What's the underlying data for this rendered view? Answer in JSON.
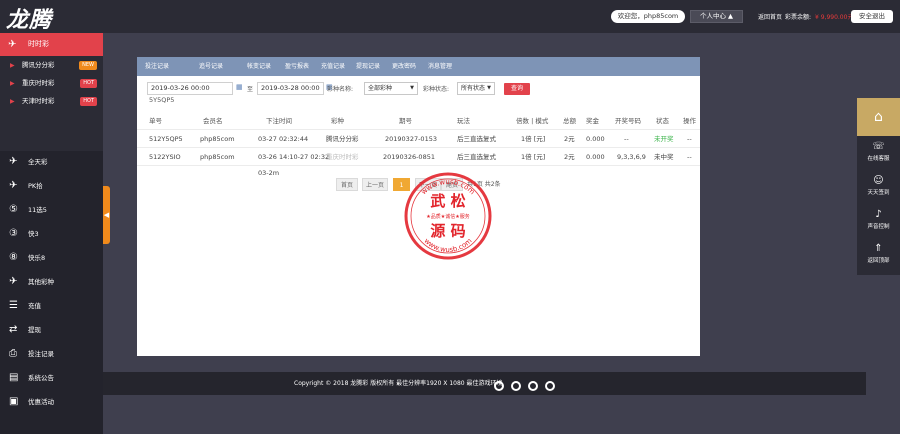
{
  "header": {
    "logo": "龙腾",
    "welcome": "欢迎您，php85com",
    "center_label": "个人中心",
    "back_home": "返回首页",
    "balance_label": "彩票余额:",
    "balance_value": "¥ 9,990.00元",
    "logout": "安全退出"
  },
  "sidebar": {
    "head": "时时彩",
    "subs": [
      {
        "label": "腾讯分分彩",
        "tag": "NEW"
      },
      {
        "label": "重庆时时彩",
        "tag": "HOT"
      },
      {
        "label": "天津时时彩",
        "tag": "HOT"
      }
    ],
    "items": [
      {
        "label": "全天彩",
        "icon": "lottery-icon",
        "glyph": "✈"
      },
      {
        "label": "PK拾",
        "icon": "racing-icon",
        "glyph": "✈"
      },
      {
        "label": "11选5",
        "icon": "eleven-five-icon",
        "glyph": "⑤"
      },
      {
        "label": "快3",
        "icon": "fast3-icon",
        "glyph": "③"
      },
      {
        "label": "快乐8",
        "icon": "happy8-icon",
        "glyph": "⑧"
      },
      {
        "label": "其他彩种",
        "icon": "other-lottery-icon",
        "glyph": "✈"
      },
      {
        "label": "充值",
        "icon": "recharge-icon",
        "glyph": "☰"
      },
      {
        "label": "提现",
        "icon": "withdraw-icon",
        "glyph": "⇄"
      },
      {
        "label": "投注记录",
        "icon": "bet-record-icon",
        "glyph": "⎙"
      },
      {
        "label": "系统公告",
        "icon": "notice-icon",
        "glyph": "▤"
      },
      {
        "label": "优惠活动",
        "icon": "promo-icon",
        "glyph": "▣"
      }
    ]
  },
  "tabs": [
    "投注记录",
    "追号记录",
    "帐变记录",
    "盈亏报表",
    "充值记录",
    "提现记录",
    "更改密码",
    "消息管理"
  ],
  "filters": {
    "start_date": "2019-03-26 00:00",
    "to_label": "至",
    "end_date": "2019-03-28 00:00",
    "lottery_label": "彩种名称:",
    "lottery_value": "全部彩种",
    "status_label": "彩种状态:",
    "status_value": "所有状态",
    "query": "查询",
    "order_fragment": "5Y5QP5"
  },
  "table": {
    "headers": [
      "单号",
      "会员名",
      "下注时间",
      "彩种",
      "期号",
      "玩法",
      "倍数 | 模式",
      "总额",
      "奖金",
      "开奖号码",
      "状态",
      "操作"
    ],
    "rows": [
      [
        "512Y5QP5",
        "php85com",
        "03-27 02:32:44",
        "腾讯分分彩",
        "20190327-0153",
        "后三直选复式",
        "1倍 [元]",
        "2元",
        "0.000",
        "--",
        "未开奖",
        "--"
      ],
      [
        "5122YSIO",
        "php85com",
        "03-26 14:10-27 02:32",
        "重庆时时彩",
        "20190326-0851",
        "后三直选复式",
        "1倍 [元]",
        "2元",
        "0.000",
        "9,3,3,6,9",
        "未中奖",
        "--"
      ]
    ],
    "extra_time": "03-2m"
  },
  "pager": {
    "first": "首页",
    "prev": "上一页",
    "current": "1",
    "next": "下一页",
    "last": "尾页",
    "total": "共1页 共2条"
  },
  "stamp": {
    "top": "www.wusb.com",
    "mid": "★品质★诚信★服务",
    "line1": "武 松",
    "line2": "源 码",
    "bottom": "www.wusb.com"
  },
  "footer": {
    "copyright": "Copyright © 2018 龙腾彩 版权所有    最佳分辨率1920 X 1080 最佳游戏环境"
  },
  "rightbar": {
    "items": [
      {
        "label": "在线客服",
        "icon": "headset-icon",
        "glyph": "☏"
      },
      {
        "label": "天天签到",
        "icon": "checkin-icon",
        "glyph": "☺"
      },
      {
        "label": "声音控制",
        "icon": "sound-icon",
        "glyph": "♪"
      },
      {
        "label": "返回顶部",
        "icon": "back-top-icon",
        "glyph": "⇑"
      }
    ]
  },
  "colors": {
    "accent_red": "#e2424b",
    "accent_orange": "#f08a1c",
    "tab_blue": "#7e94b6",
    "gold": "#c8a964",
    "dark": "#2b2b35"
  }
}
